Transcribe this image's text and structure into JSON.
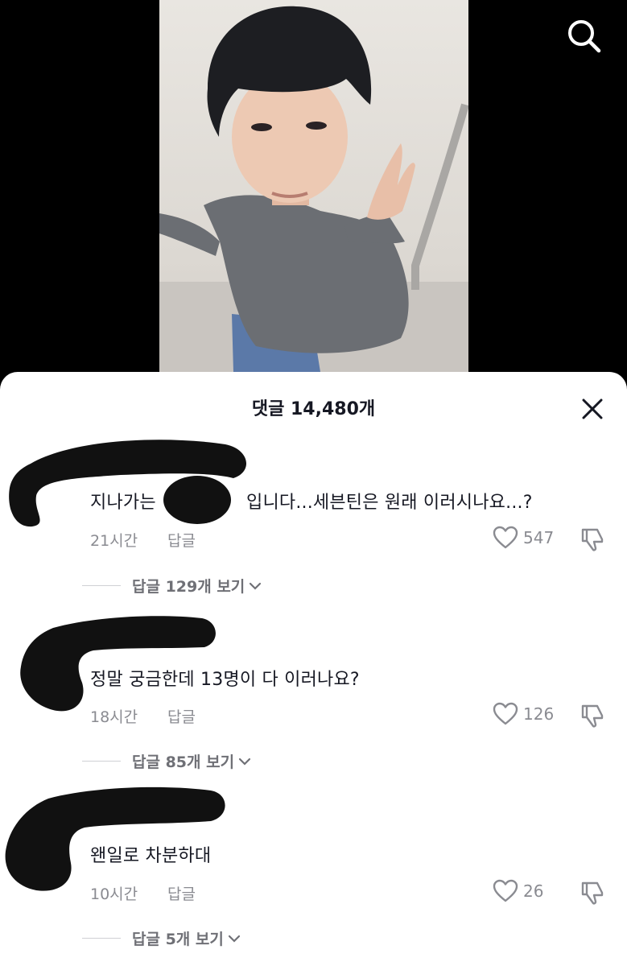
{
  "sheet": {
    "title": "댓글 14,480개"
  },
  "comments": [
    {
      "text_before": "지나가는",
      "text_after": "입니다...세븐틴은 원래 이러시나요...?",
      "time": "21시간",
      "reply_label": "답글",
      "likes": "547",
      "view_replies": "답글 129개 보기"
    },
    {
      "text": "정말 궁금한데 13명이 다 이러나요?",
      "time": "18시간",
      "reply_label": "답글",
      "likes": "126",
      "view_replies": "답글 85개 보기"
    },
    {
      "text": "왠일로 차분하대",
      "time": "10시간",
      "reply_label": "답글",
      "likes": "26",
      "view_replies": "답글 5개 보기"
    }
  ],
  "icons": {
    "search": "search-icon",
    "close": "close-icon",
    "like": "heart-outline-icon",
    "dislike": "thumbs-down-icon",
    "chevron": "chevron-down-icon"
  }
}
